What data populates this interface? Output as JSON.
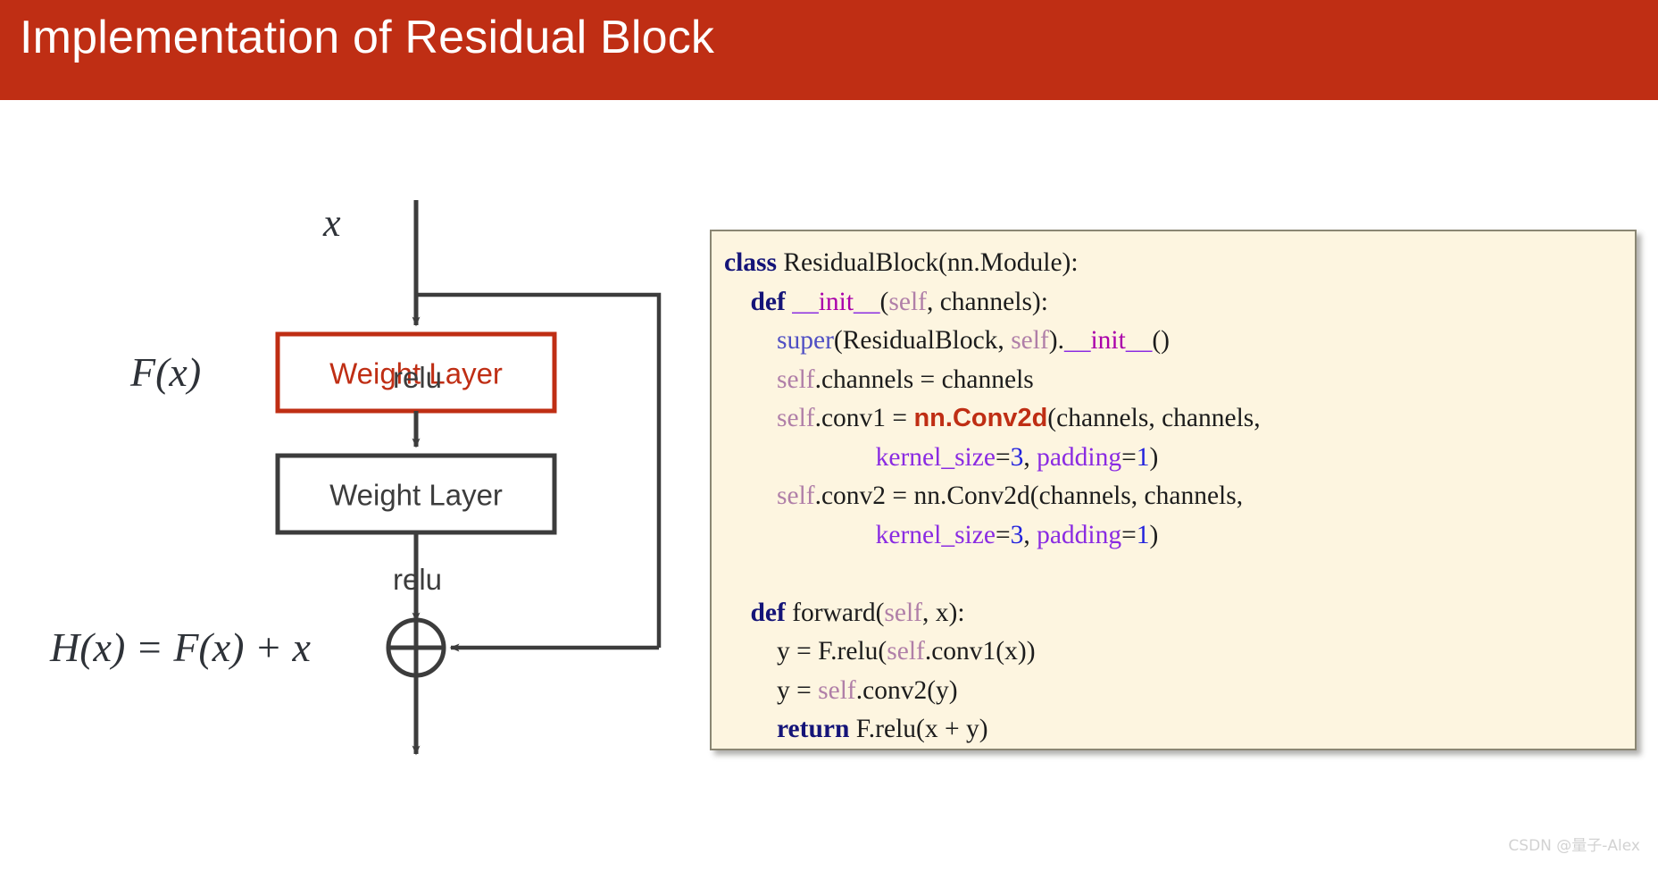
{
  "slide": {
    "title": "Implementation of Residual Block",
    "banner_color": "#BF2E14",
    "background_color": "#FFFFFF"
  },
  "diagram": {
    "name": "residual-block-diagram",
    "input_label": "x",
    "residual_label": "F(x)",
    "output_equation": "H(x) = F(x) + x",
    "boxes": [
      {
        "label": "Weight Layer",
        "border_color": "#BF2E14",
        "text_color": "#BF2E14"
      },
      {
        "label": "Weight Layer",
        "border_color": "#3C3C3C",
        "text_color": "#3C3C3C"
      }
    ],
    "activation_labels": [
      "relu",
      "relu"
    ],
    "adder_symbol": "circled-plus",
    "line_color": "#3C3C3C"
  },
  "code": {
    "background_color": "#FDF5E0",
    "border_color": "#8A8673",
    "language": "python",
    "highlight_token": "nn.Conv2d",
    "lines": [
      "class ResidualBlock(nn.Module):",
      "    def __init__(self, channels):",
      "        super(ResidualBlock, self).__init__()",
      "        self.channels = channels",
      "        self.conv1 = nn.Conv2d(channels, channels,",
      "                               kernel_size=3, padding=1)",
      "        self.conv2 = nn.Conv2d(channels, channels,",
      "                               kernel_size=3, padding=1)",
      "",
      "    def forward(self, x):",
      "        y = F.relu(self.conv1(x))",
      "        y = self.conv2(y)",
      "        return F.relu(x + y)"
    ]
  },
  "watermark": {
    "text": "CSDN @量子-Alex"
  }
}
